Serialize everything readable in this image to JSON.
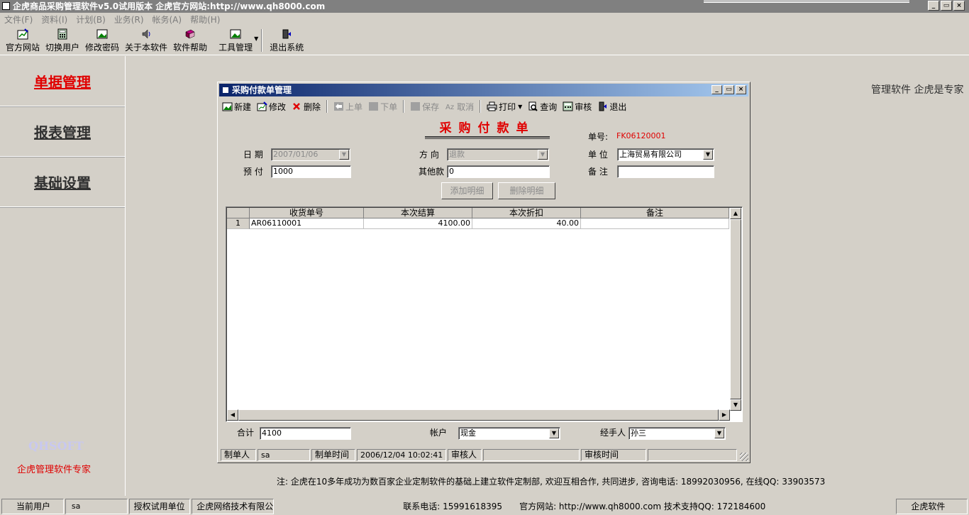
{
  "window": {
    "title": "企虎商品采购管理软件v5.0试用版本 企虎官方网站:http://www.qh8000.com",
    "min": "_",
    "max": "▭",
    "close": "×"
  },
  "menu": [
    "文件(F)",
    "资料(I)",
    "计划(B)",
    "业务(R)",
    "帐务(A)",
    "帮助(H)"
  ],
  "toolbar": {
    "official_site": "官方网站",
    "switch_user": "切换用户",
    "change_password": "修改密码",
    "about": "关于本软件",
    "help": "软件帮助",
    "tools": "工具管理",
    "exit": "退出系统"
  },
  "sidebar": {
    "items": [
      "单据管理",
      "报表管理",
      "基础设置"
    ],
    "logo": "QHSOFT",
    "slogan": "企虎管理软件专家"
  },
  "top_right_text": "管理软件  企虎是专家",
  "dialog": {
    "title": "采购付款单管理",
    "toolbar": {
      "new": "新建",
      "edit": "修改",
      "delete": "删除",
      "prev": "上单",
      "next": "下单",
      "save": "保存",
      "cancel": "取消",
      "print": "打印",
      "query": "查询",
      "audit": "审核",
      "exit": "退出"
    },
    "form_title": "采购付款单",
    "doc_no_label": "单号:",
    "doc_no": "FK06120001",
    "date_label": "日 期",
    "date_value": "2007/01/06",
    "direction_label": "方 向",
    "direction_value": "退款",
    "unit_label": "单 位",
    "unit_value": "上海贸易有限公司",
    "prepay_label": "预 付",
    "prepay_value": "1000",
    "other_label": "其他款",
    "other_value": "0",
    "remark_label": "备 注",
    "remark_value": "",
    "add_detail": "添加明细",
    "delete_detail": "删除明细",
    "grid": {
      "columns": [
        "收货单号",
        "本次结算",
        "本次折扣",
        "备注"
      ],
      "rows": [
        {
          "index": "1",
          "receipt_no": "AR06110001",
          "settle": "4100.00",
          "discount": "40.00",
          "note": ""
        }
      ]
    },
    "total_label": "合计",
    "total_value": "4100",
    "account_label": "帐户",
    "account_value": "现金",
    "handler_label": "经手人",
    "handler_value": "孙三",
    "status": {
      "maker_label": "制单人",
      "maker_value": "sa",
      "make_time_label": "制单时间",
      "make_time_value": "2006/12/04 10:02:41",
      "auditor_label": "审核人",
      "auditor_value": "",
      "audit_time_label": "审核时间",
      "audit_time_value": ""
    }
  },
  "footer_note": "注: 企虎在10多年成功为数百家企业定制软件的基础上建立软件定制部, 欢迎互相合作, 共同进步, 咨询电话: 18992030956,  在线QQ: 33903573",
  "statusbar": {
    "current_user_label": "当前用户",
    "current_user_value": "sa",
    "licensee_label": "授权试用单位",
    "licensee_value": "企虎网络技术有限公司",
    "contact": "联系电话: 15991618395",
    "site": "官方网站: http://www.qh8000.com 技术支持QQ: 172184600",
    "brand": "企虎软件"
  },
  "colors": {
    "accent_red": "#e00000",
    "title_blue": "#0a246a",
    "face": "#d4d0c8"
  }
}
